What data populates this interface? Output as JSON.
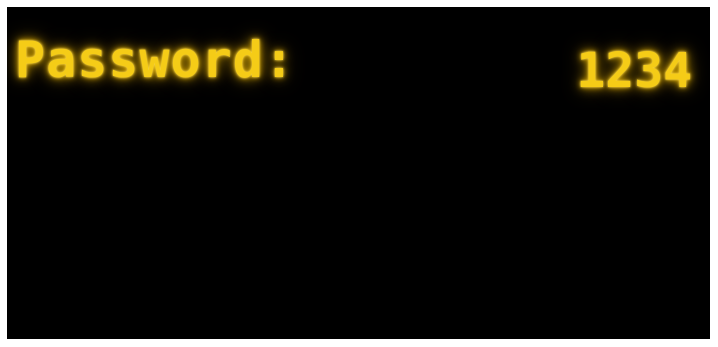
{
  "display": {
    "label": "Password:",
    "value": "1234"
  },
  "colors": {
    "background": "#000000",
    "text_glow": "#f5cc17",
    "frame": "#ffffff"
  }
}
